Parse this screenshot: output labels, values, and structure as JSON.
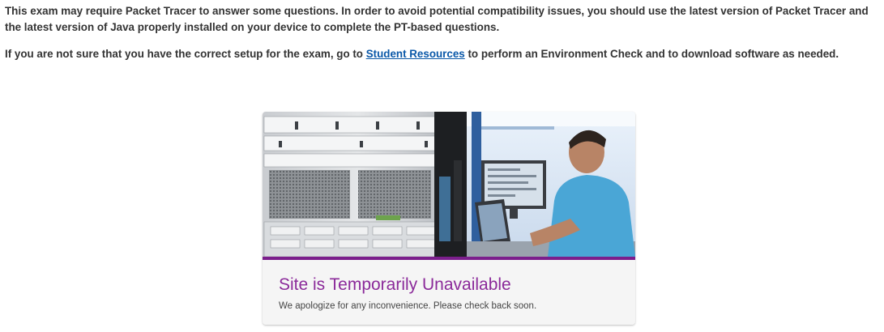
{
  "notice": {
    "para1": "This exam may require Packet Tracer to answer some questions.  In order to avoid potential compatibility issues, you should use the latest version of Packet Tracer and the latest version of Java properly installed on your device to complete the PT-based questions.",
    "para2_before": "If you are not sure that you have the correct setup for the exam, go to ",
    "para2_link": "Student Resources",
    "para2_after": " to perform an Environment Check and to download software as needed."
  },
  "unavailable_card": {
    "image_description": "server-rack-and-technician-photo",
    "title": "Site is Temporarily Unavailable",
    "subtitle": "We apologize for any inconvenience. Please check back soon."
  },
  "colors": {
    "accent": "#7b1e8c",
    "title": "#8b2a9a",
    "link": "#0a58a8"
  }
}
